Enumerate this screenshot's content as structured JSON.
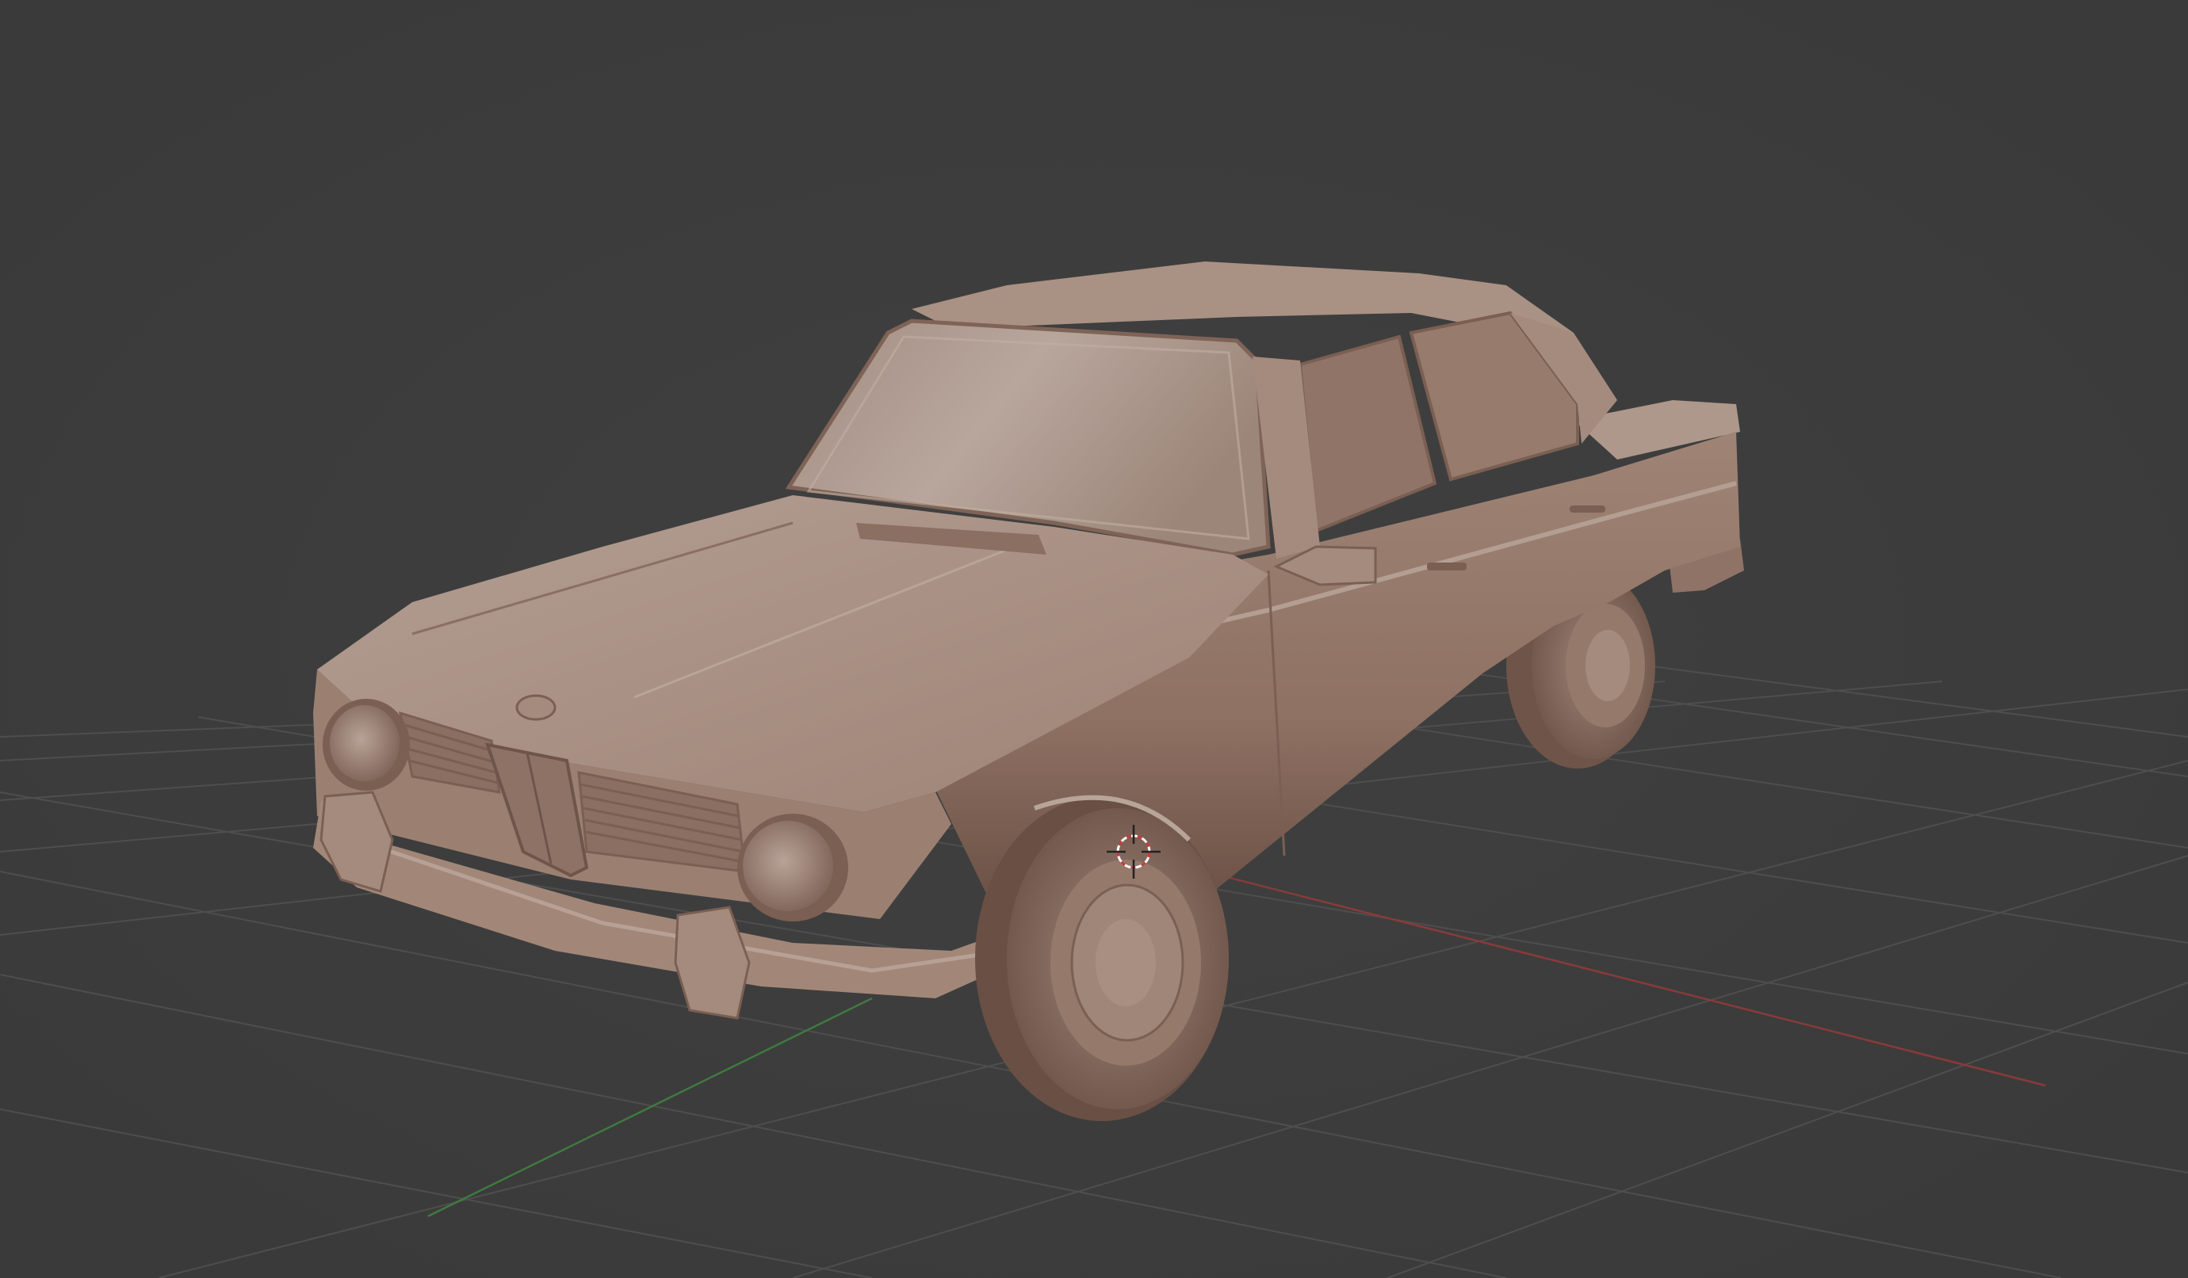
{
  "viewport": {
    "background": "#3d3d3d",
    "grid_color": "#4e4e4e",
    "axis_x_color": "#8a3a3a",
    "axis_y_color": "#3f7a3f",
    "clay_color": "#a48a7c",
    "clay_shadow": "#6f5549",
    "clay_highlight": "#c0ada2"
  },
  "scene": {
    "object": "car-model",
    "view_mode": "perspective",
    "shading": "solid",
    "cursor": "3d-cursor-icon"
  }
}
